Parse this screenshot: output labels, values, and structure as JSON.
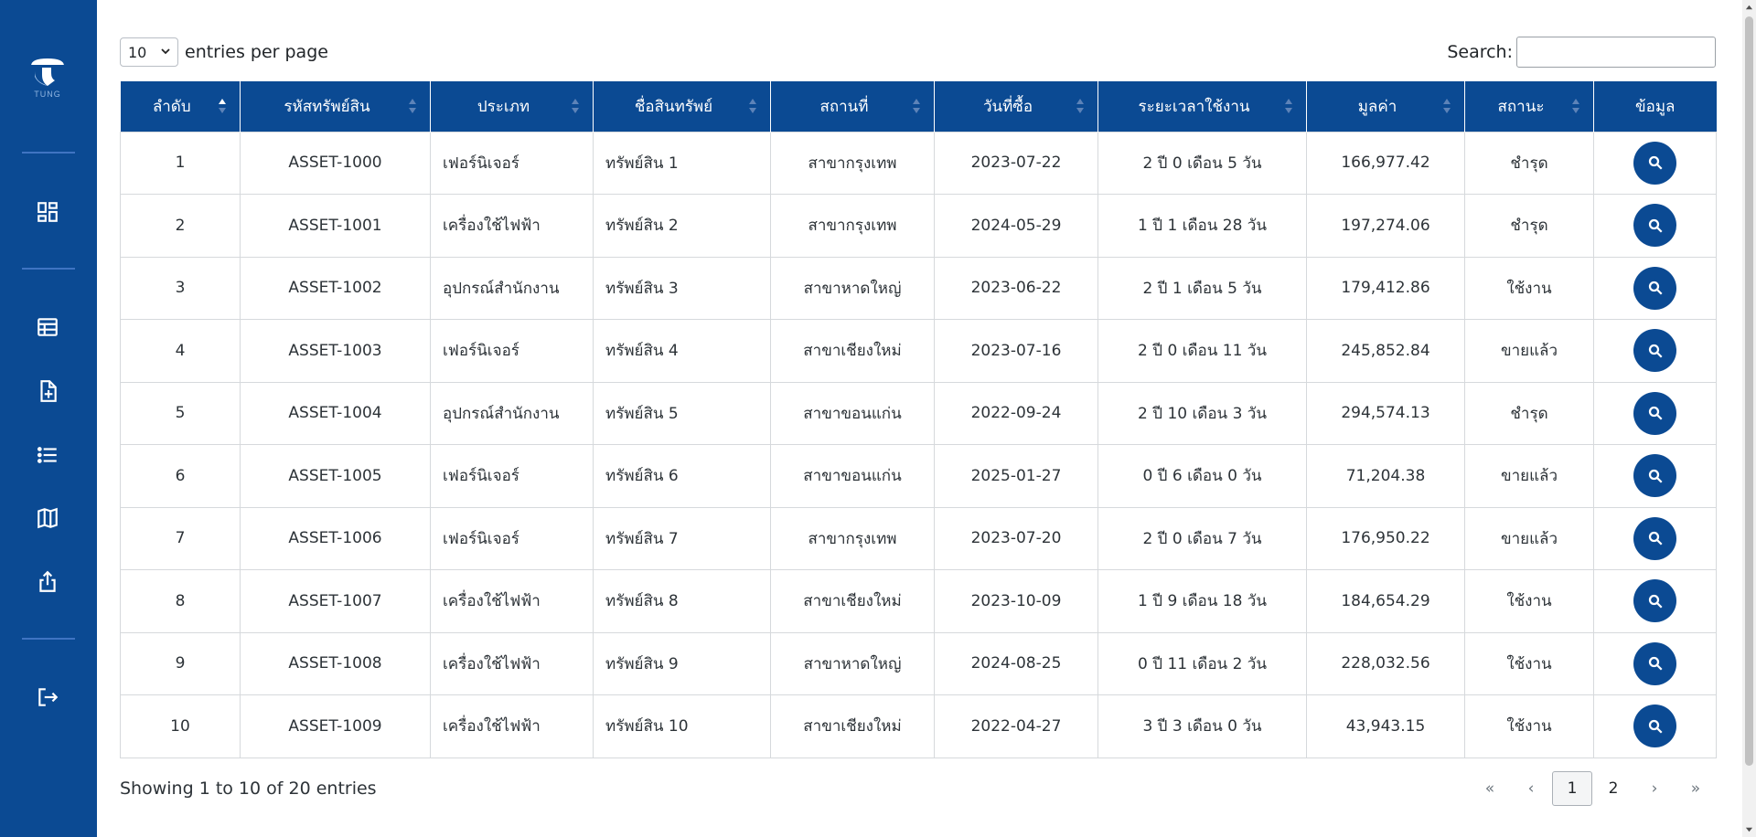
{
  "brand": {
    "name": "TUNG"
  },
  "sidebar": {
    "items": [
      {
        "icon": "dashboard-icon"
      },
      {
        "icon": "table-icon"
      },
      {
        "icon": "add-document-icon"
      },
      {
        "icon": "list-icon"
      },
      {
        "icon": "map-icon"
      },
      {
        "icon": "share-export-icon"
      },
      {
        "icon": "logout-icon"
      }
    ]
  },
  "controls": {
    "entries_value": "10",
    "entries_label": "entries per page",
    "search_label": "Search:",
    "search_value": ""
  },
  "table": {
    "columns": [
      "ลำดับ",
      "รหัสทรัพย์สิน",
      "ประเภท",
      "ชื่อสินทรัพย์",
      "สถานที่",
      "วันที่ซื้อ",
      "ระยะเวลาใช้งาน",
      "มูลค่า",
      "สถานะ",
      "ข้อมูล"
    ],
    "rows": [
      [
        "1",
        "ASSET-1000",
        "เฟอร์นิเจอร์",
        "ทรัพย์สิน 1",
        "สาขากรุงเทพ",
        "2023-07-22",
        "2 ปี 0 เดือน 5 วัน",
        "166,977.42",
        "ชำรุด"
      ],
      [
        "2",
        "ASSET-1001",
        "เครื่องใช้ไฟฟ้า",
        "ทรัพย์สิน 2",
        "สาขากรุงเทพ",
        "2024-05-29",
        "1 ปี 1 เดือน 28 วัน",
        "197,274.06",
        "ชำรุด"
      ],
      [
        "3",
        "ASSET-1002",
        "อุปกรณ์สำนักงาน",
        "ทรัพย์สิน 3",
        "สาขาหาดใหญ่",
        "2023-06-22",
        "2 ปี 1 เดือน 5 วัน",
        "179,412.86",
        "ใช้งาน"
      ],
      [
        "4",
        "ASSET-1003",
        "เฟอร์นิเจอร์",
        "ทรัพย์สิน 4",
        "สาขาเชียงใหม่",
        "2023-07-16",
        "2 ปี 0 เดือน 11 วัน",
        "245,852.84",
        "ขายแล้ว"
      ],
      [
        "5",
        "ASSET-1004",
        "อุปกรณ์สำนักงาน",
        "ทรัพย์สิน 5",
        "สาขาขอนแก่น",
        "2022-09-24",
        "2 ปี 10 เดือน 3 วัน",
        "294,574.13",
        "ชำรุด"
      ],
      [
        "6",
        "ASSET-1005",
        "เฟอร์นิเจอร์",
        "ทรัพย์สิน 6",
        "สาขาขอนแก่น",
        "2025-01-27",
        "0 ปี 6 เดือน 0 วัน",
        "71,204.38",
        "ขายแล้ว"
      ],
      [
        "7",
        "ASSET-1006",
        "เฟอร์นิเจอร์",
        "ทรัพย์สิน 7",
        "สาขากรุงเทพ",
        "2023-07-20",
        "2 ปี 0 เดือน 7 วัน",
        "176,950.22",
        "ขายแล้ว"
      ],
      [
        "8",
        "ASSET-1007",
        "เครื่องใช้ไฟฟ้า",
        "ทรัพย์สิน 8",
        "สาขาเชียงใหม่",
        "2023-10-09",
        "1 ปี 9 เดือน 18 วัน",
        "184,654.29",
        "ใช้งาน"
      ],
      [
        "9",
        "ASSET-1008",
        "เครื่องใช้ไฟฟ้า",
        "ทรัพย์สิน 9",
        "สาขาหาดใหญ่",
        "2024-08-25",
        "0 ปี 11 เดือน 2 วัน",
        "228,032.56",
        "ใช้งาน"
      ],
      [
        "10",
        "ASSET-1009",
        "เครื่องใช้ไฟฟ้า",
        "ทรัพย์สิน 10",
        "สาขาเชียงใหม่",
        "2022-04-27",
        "3 ปี 3 เดือน 0 วัน",
        "43,943.15",
        "ใช้งาน"
      ]
    ]
  },
  "footer": {
    "info": "Showing 1 to 10 of 20 entries",
    "pager": {
      "first": "«",
      "prev": "‹",
      "pages": [
        "1",
        "2"
      ],
      "current": "1",
      "next": "›",
      "last": "»"
    }
  },
  "colors": {
    "primary": "#0b4a93",
    "divider": "#3f74c2"
  }
}
